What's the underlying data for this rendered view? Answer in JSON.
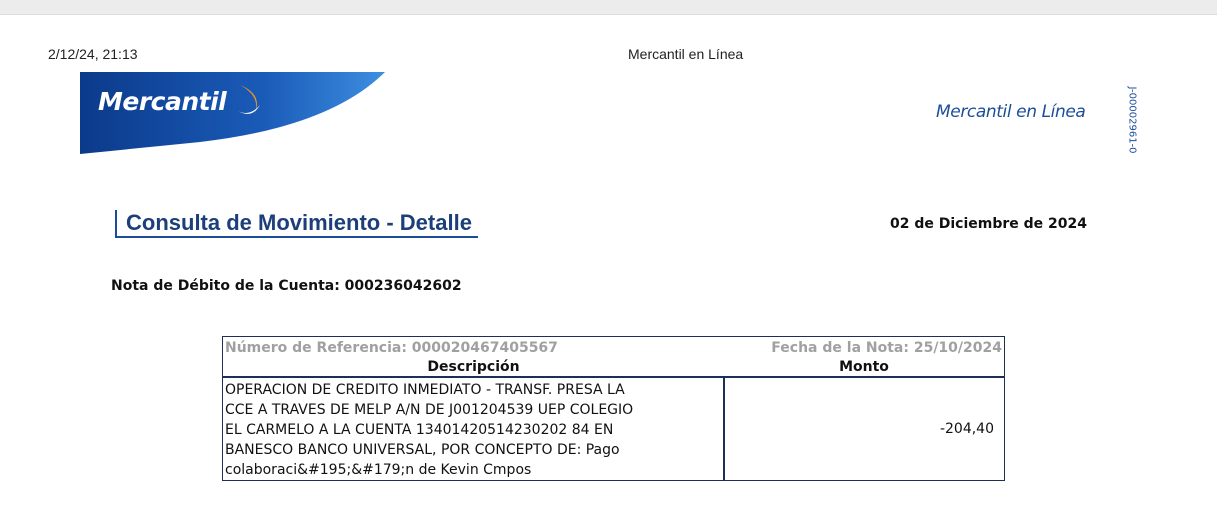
{
  "print_header": {
    "datetime": "2/12/24, 21:13",
    "title": "Mercantil en Línea"
  },
  "logo": {
    "text": "Mercantil",
    "colors": {
      "banner_dark": "#0b3a8a",
      "banner_light": "#2f7fd6",
      "swoosh": "#f39a1e"
    }
  },
  "brand_right": "Mercantil en Línea",
  "rif": "J-00002961-0",
  "heading": "Consulta de Movimiento - Detalle",
  "date": "02 de Diciembre de 2024",
  "account_line": "Nota de Débito de la Cuenta: 000236042602",
  "table": {
    "reference": "Número de Referencia: 000020467405567",
    "note_date": "Fecha de la Nota: 25/10/2024",
    "col_description": "Descripción",
    "col_amount": "Monto",
    "description_lines": [
      "OPERACION DE CREDITO INMEDIATO - TRANSF. PRESA LA",
      "CCE A TRAVES DE MELP A/N DE J001204539 UEP COLEGIO",
      "EL CARMELO A LA CUENTA 13401420514230202 84 EN",
      "BANESCO BANCO UNIVERSAL, POR CONCEPTO DE: Pago",
      "colaboraci&#195;&#179;n de Kevin Cmpos"
    ],
    "amount": "-204,40"
  }
}
